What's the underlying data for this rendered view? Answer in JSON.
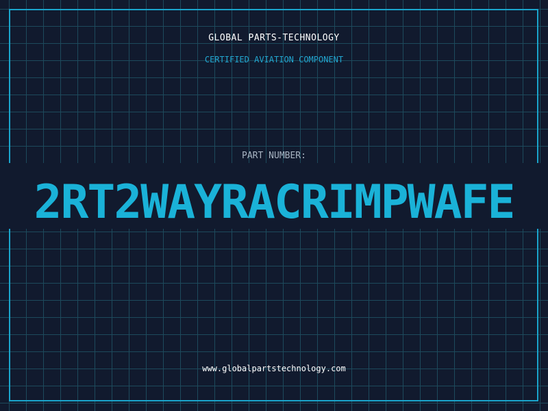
{
  "header": {
    "company": "GLOBAL PARTS-TECHNOLOGY",
    "subtitle": "CERTIFIED AVIATION COMPONENT"
  },
  "part": {
    "label": "PART NUMBER:",
    "number": "2RT2WAYRACRIMPWAFE"
  },
  "footer": {
    "url": "www.globalpartstechnology.com"
  },
  "colors": {
    "background": "#111a2e",
    "grid": "#1d4a5c",
    "accent": "#1aa5cc",
    "text": "#ffffff",
    "muted": "#a8b4c2"
  }
}
